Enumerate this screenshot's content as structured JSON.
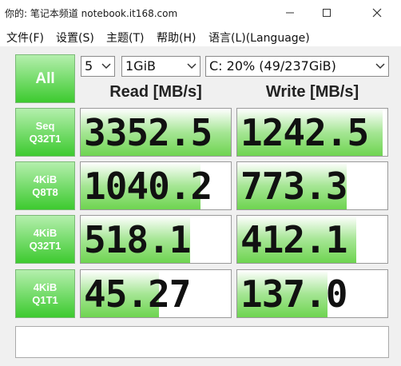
{
  "window": {
    "title": "你的: 笔记本频道 notebook.it168.com",
    "controls": {
      "minimize_icon": "minimize-icon",
      "maximize_icon": "maximize-icon",
      "close_icon": "close-icon"
    }
  },
  "menu": {
    "items": [
      "文件(F)",
      "设置(S)",
      "主题(T)",
      "帮助(H)",
      "语言(L)(Language)"
    ]
  },
  "toolbar": {
    "all_label": "All",
    "count_value": "5",
    "size_value": "1GiB",
    "drive_value": "C: 20% (49/237GiB)"
  },
  "headers": {
    "read": "Read [MB/s]",
    "write": "Write [MB/s]"
  },
  "tests": [
    {
      "line1": "Seq",
      "line2": "Q32T1",
      "read": "3352.5",
      "write": "1242.5",
      "read_fill": 1.0,
      "write_fill": 0.97
    },
    {
      "line1": "4KiB",
      "line2": "Q8T8",
      "read": "1040.2",
      "write": "773.3",
      "read_fill": 0.8,
      "write_fill": 0.73
    },
    {
      "line1": "4KiB",
      "line2": "Q32T1",
      "read": "518.1",
      "write": "412.1",
      "read_fill": 0.73,
      "write_fill": 0.79
    },
    {
      "line1": "4KiB",
      "line2": "Q1T1",
      "read": "45.27",
      "write": "137.0",
      "read_fill": 0.52,
      "write_fill": 0.6
    }
  ],
  "colors": {
    "accent_green": "#3dca2f",
    "bar_green": "#6ed450"
  }
}
